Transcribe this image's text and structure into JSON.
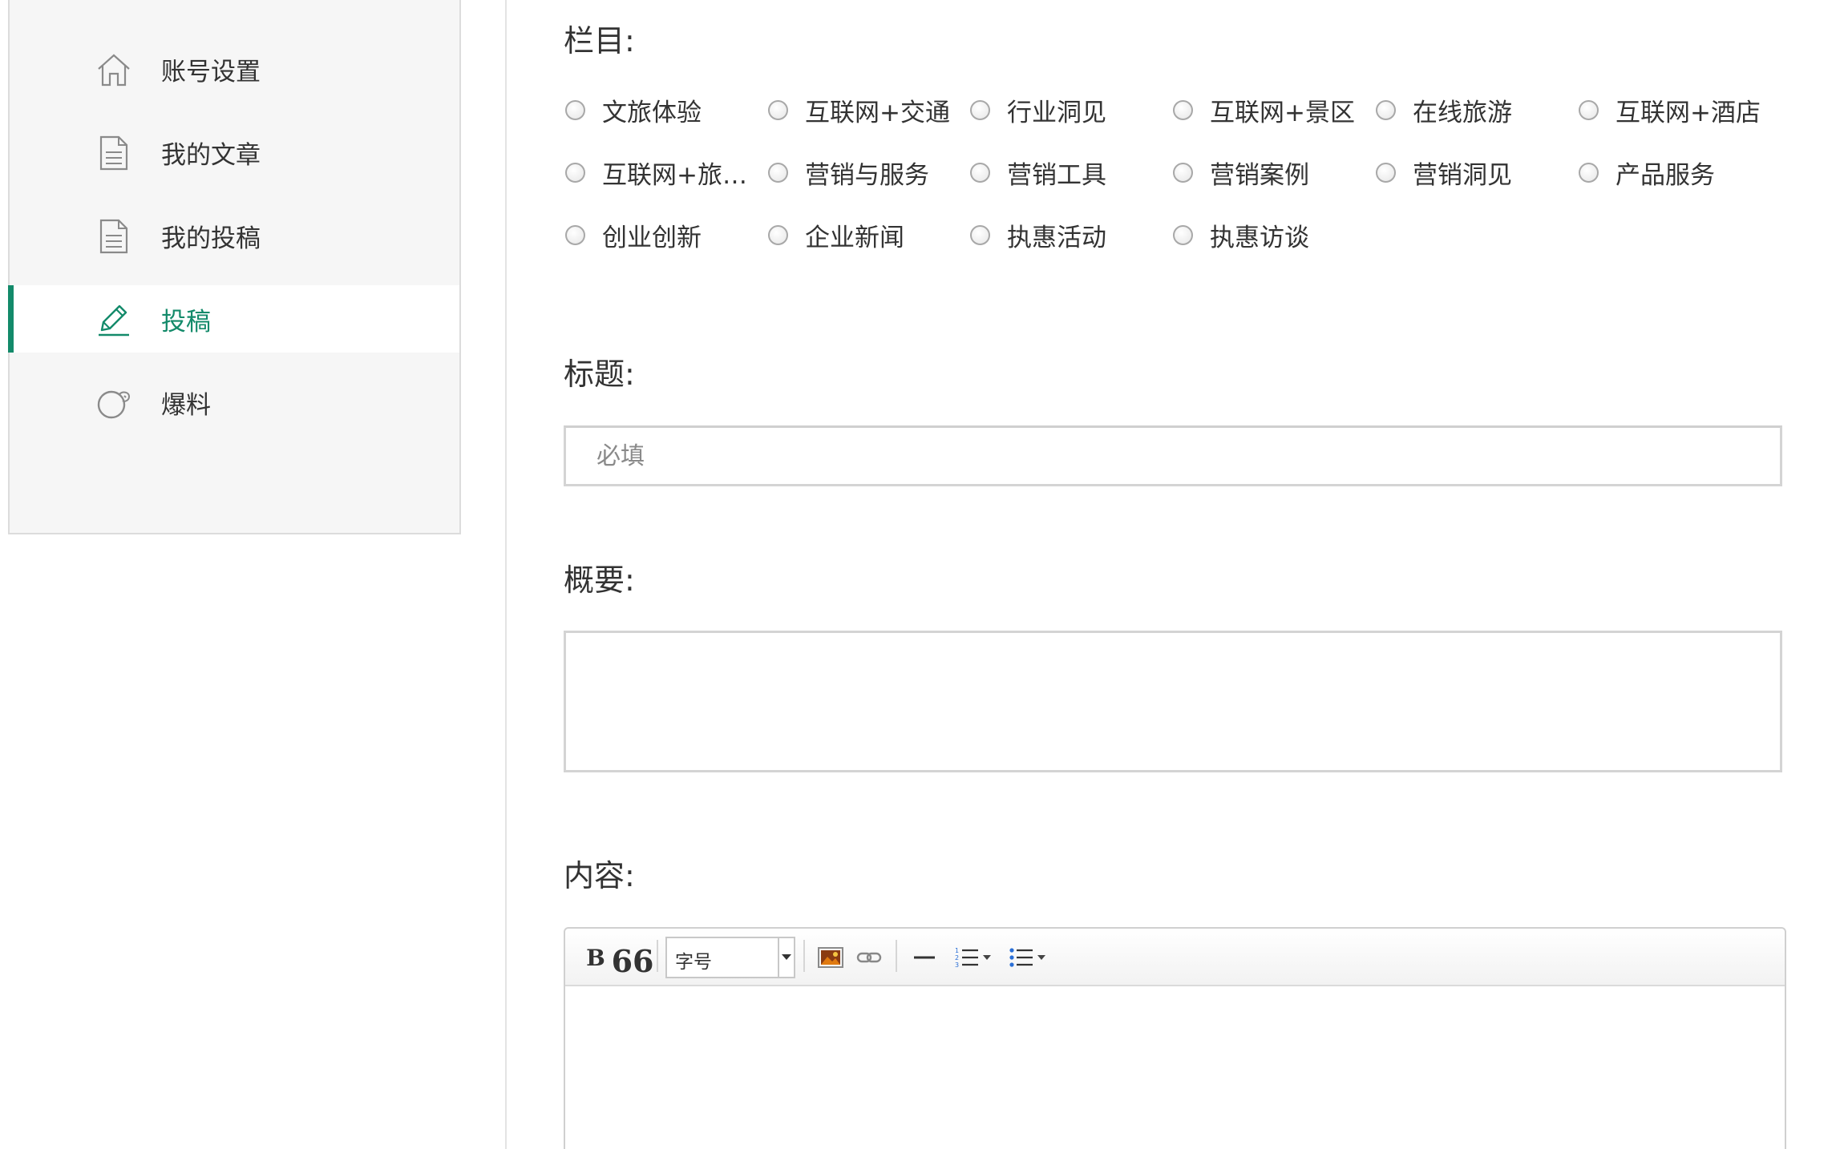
{
  "sidebar": {
    "items": [
      {
        "label": "账号设置",
        "icon": "home-icon",
        "active": false
      },
      {
        "label": "我的文章",
        "icon": "document-icon",
        "active": false
      },
      {
        "label": "我的投稿",
        "icon": "document-icon",
        "active": false
      },
      {
        "label": "投稿",
        "icon": "edit-icon",
        "active": true
      },
      {
        "label": "爆料",
        "icon": "scoop-icon",
        "active": false
      }
    ],
    "accent_color": "#138a6a"
  },
  "form": {
    "category": {
      "label": "栏目:",
      "options": [
        "文旅体验",
        "互联网+交通",
        "行业洞见",
        "互联网+景区",
        "在线旅游",
        "互联网+酒店",
        "互联网+旅行社",
        "营销与服务",
        "营销工具",
        "营销案例",
        "营销洞见",
        "产品服务",
        "创业创新",
        "企业新闻",
        "执惠活动",
        "执惠访谈"
      ]
    },
    "title": {
      "label": "标题:",
      "placeholder": "必填",
      "value": ""
    },
    "summary": {
      "label": "概要:",
      "value": ""
    },
    "content": {
      "label": "内容:",
      "toolbar": {
        "bold": "B",
        "quote": "66",
        "font_size_select": "字号",
        "icons": [
          "bold-icon",
          "quote-icon",
          "image-icon",
          "link-icon",
          "horizontal-rule-icon",
          "ordered-list-icon",
          "unordered-list-icon"
        ]
      }
    }
  }
}
